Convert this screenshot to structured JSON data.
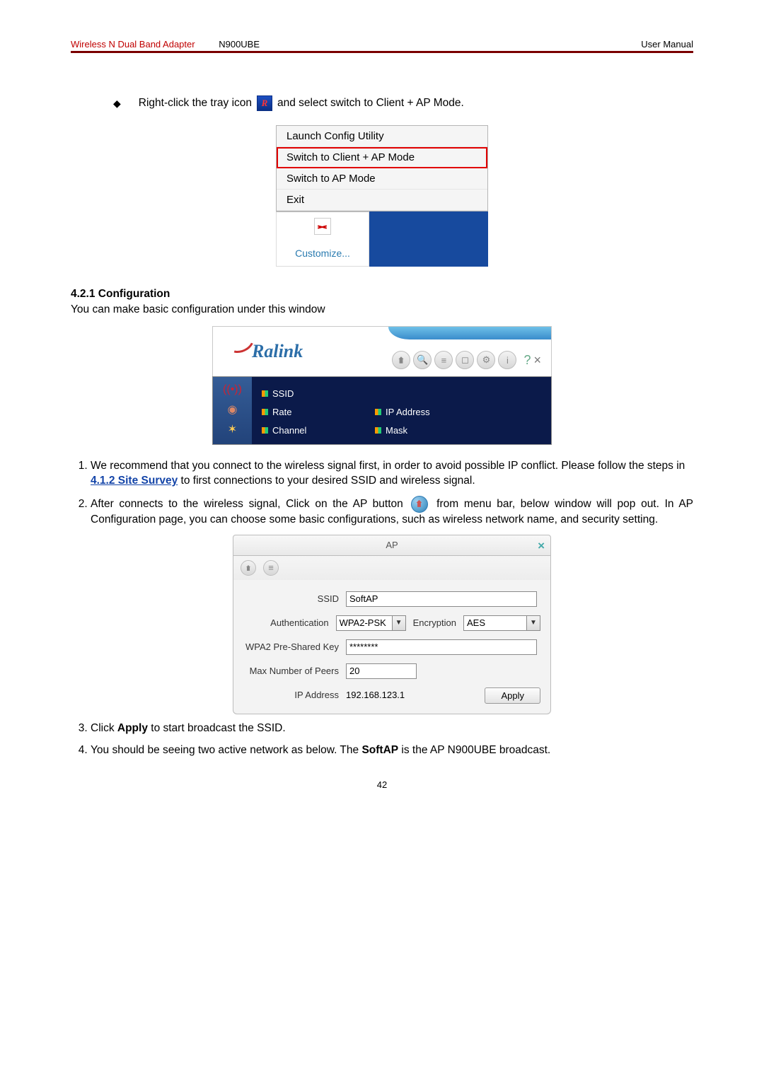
{
  "header": {
    "product": "Wireless N Dual Band Adapter",
    "model": "N900UBE",
    "doc_type": "User Manual"
  },
  "intro": {
    "bullet_before": "Right-click the tray icon",
    "bullet_after": "and select switch to Client + AP Mode."
  },
  "context_menu": {
    "items": [
      "Launch Config Utility",
      "Switch to Client + AP Mode",
      "Switch to AP Mode",
      "Exit"
    ],
    "customize": "Customize..."
  },
  "section_heading": "4.2.1 Configuration",
  "section_intro": "You can make basic configuration under this window",
  "ralink": {
    "brand": "Ralink",
    "help": "?",
    "close": "×",
    "fields": {
      "ssid": "SSID",
      "rate": "Rate",
      "channel": "Channel",
      "ip": "IP Address",
      "mask": "Mask"
    }
  },
  "steps": {
    "s1a": "We recommend that you connect to the wireless signal first, in order to avoid possible IP conflict. Please follow the steps in ",
    "s1_link": "4.1.2 Site Survey",
    "s1b": " to first connections to your desired SSID and wireless signal.",
    "s2a": "After connects to the wireless signal, Click on the AP button",
    "s2b": "from menu bar, below window will pop out. In AP Configuration page, you can choose some basic configurations, such as wireless network name, and security setting.",
    "s3": "Click ",
    "s3b": " to start broadcast the SSID.",
    "s3_bold": "Apply",
    "s4a": "You should be seeing two active network as below. The ",
    "s4_bold": "SoftAP",
    "s4b": " is the AP N900UBE broadcast."
  },
  "ap_window": {
    "title": "AP",
    "labels": {
      "ssid": "SSID",
      "auth": "Authentication",
      "enc": "Encryption",
      "psk": "WPA2 Pre-Shared Key",
      "maxpeers": "Max Number of Peers",
      "ip": "IP Address"
    },
    "values": {
      "ssid": "SoftAP",
      "auth": "WPA2-PSK",
      "enc": "AES",
      "psk": "********",
      "maxpeers": "20",
      "ip": "192.168.123.1"
    },
    "apply": "Apply"
  },
  "page_number": "42"
}
